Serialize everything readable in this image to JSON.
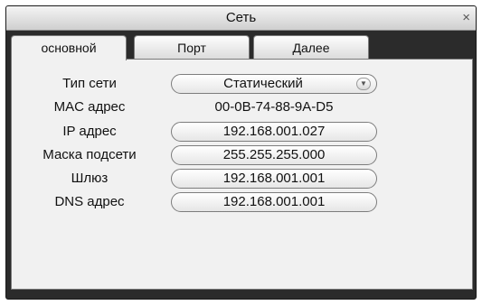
{
  "window": {
    "title": "Сеть",
    "close_glyph": "×"
  },
  "tabs": [
    {
      "label": "основной",
      "active": true
    },
    {
      "label": "Порт",
      "active": false
    },
    {
      "label": "Далее",
      "active": false
    }
  ],
  "form": {
    "network_type": {
      "label": "Тип сети",
      "value": "Статический"
    },
    "mac": {
      "label": "MAC адрес",
      "value": "00-0B-74-88-9A-D5"
    },
    "ip": {
      "label": "IP адрес",
      "value": "192.168.001.027"
    },
    "mask": {
      "label": "Маска подсети",
      "value": "255.255.255.000"
    },
    "gateway": {
      "label": "Шлюз",
      "value": "192.168.001.001"
    },
    "dns": {
      "label": "DNS адрес",
      "value": "192.168.001.001"
    }
  }
}
